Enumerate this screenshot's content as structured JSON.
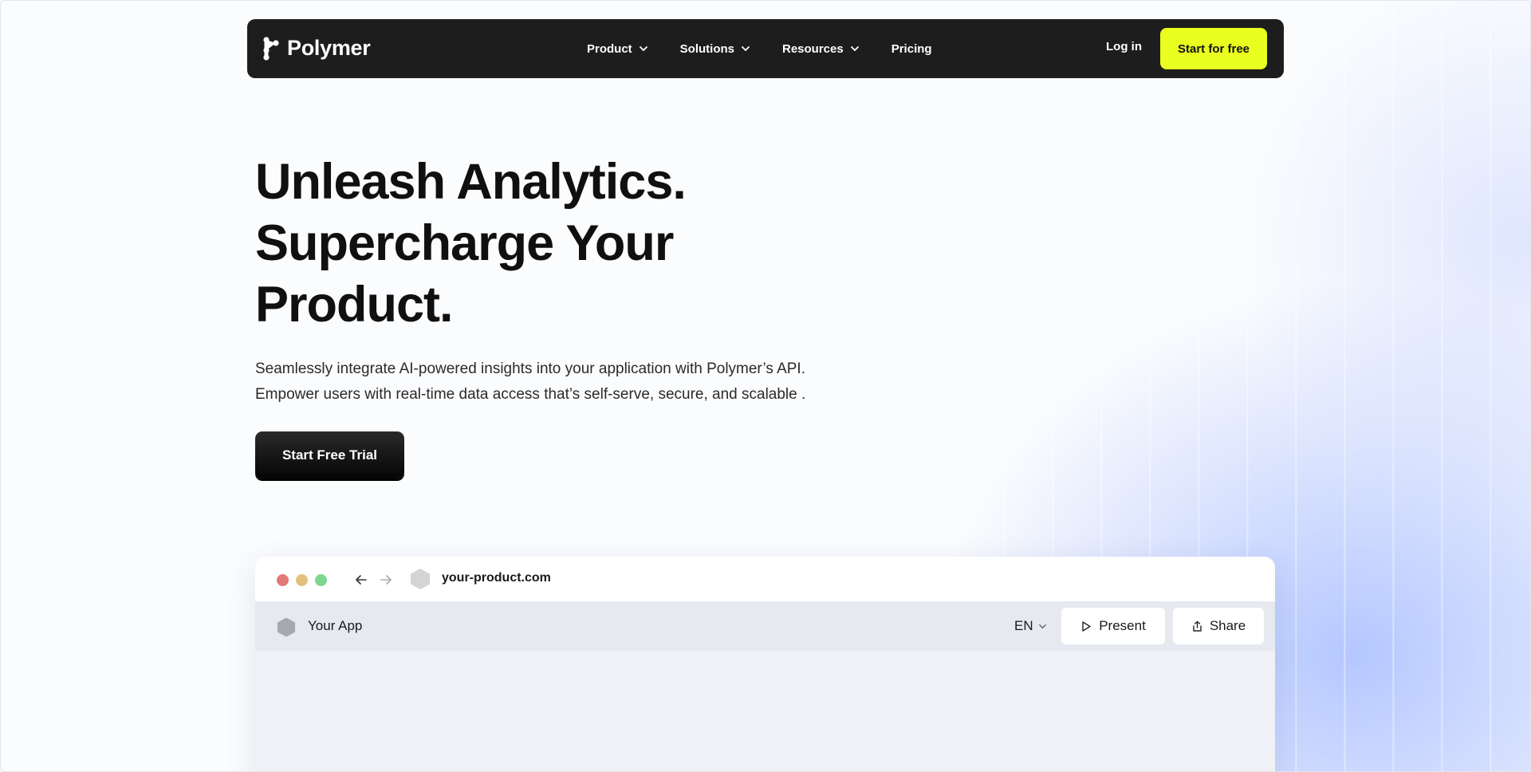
{
  "brand": {
    "name": "Polymer"
  },
  "nav": {
    "items": [
      {
        "label": "Product",
        "has_dropdown": true
      },
      {
        "label": "Solutions",
        "has_dropdown": true
      },
      {
        "label": "Resources",
        "has_dropdown": true
      },
      {
        "label": "Pricing",
        "has_dropdown": false
      }
    ],
    "login_label": "Log in",
    "cta_label": "Start for free"
  },
  "hero": {
    "title_lines": [
      "Unleash Analytics.",
      "Supercharge Your",
      "Product."
    ],
    "subtitle_lines": [
      "Seamlessly integrate AI-powered insights into your application with Polymer’s API.",
      "Empower users with real-time data access that’s self-serve, secure, and scalable ."
    ],
    "trial_button_label": "Start Free Trial"
  },
  "browser_mock": {
    "url": "your-product.com",
    "app_name": "Your App",
    "language": "EN",
    "present_label": "Present",
    "share_label": "Share"
  },
  "colors": {
    "nav_bg": "#1d1d1d",
    "cta_accent": "#e9ff1f",
    "glow": "#a8beff"
  },
  "icons": [
    "polymer-logo-icon",
    "chevron-down-icon",
    "arrow-left-icon",
    "arrow-right-icon",
    "hexagon-icon",
    "play-icon",
    "share-icon"
  ]
}
